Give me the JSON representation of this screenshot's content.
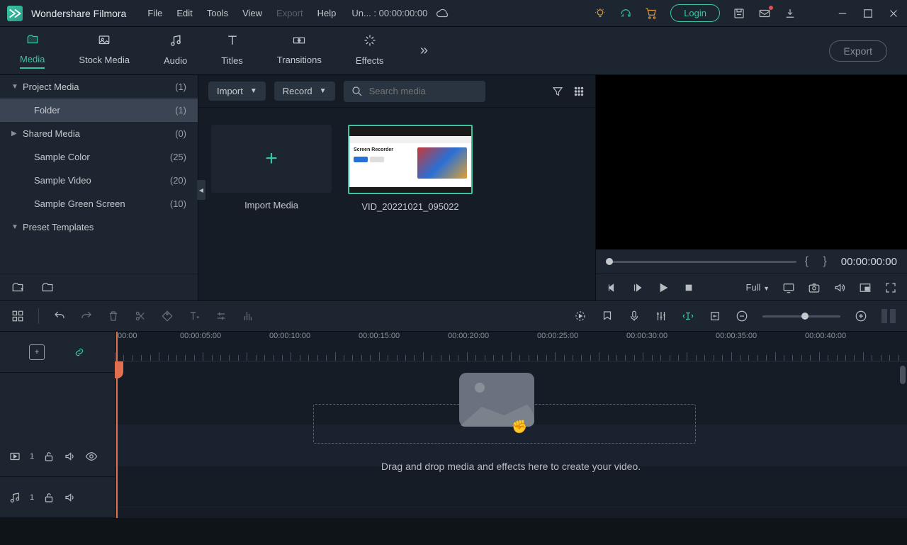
{
  "titlebar": {
    "app_name": "Wondershare Filmora",
    "menu": {
      "file": "File",
      "edit": "Edit",
      "tools": "Tools",
      "view": "View",
      "export": "Export",
      "help": "Help"
    },
    "project_info": "Un... : 00:00:00:00",
    "login": "Login"
  },
  "tabs": {
    "media": "Media",
    "stock": "Stock Media",
    "audio": "Audio",
    "titles": "Titles",
    "transitions": "Transitions",
    "effects": "Effects",
    "export": "Export"
  },
  "sidebar": {
    "project_media": {
      "label": "Project Media",
      "count": "(1)"
    },
    "folder": {
      "label": "Folder",
      "count": "(1)"
    },
    "shared_media": {
      "label": "Shared Media",
      "count": "(0)"
    },
    "sample_color": {
      "label": "Sample Color",
      "count": "(25)"
    },
    "sample_video": {
      "label": "Sample Video",
      "count": "(20)"
    },
    "sample_green": {
      "label": "Sample Green Screen",
      "count": "(10)"
    },
    "preset": {
      "label": "Preset Templates"
    }
  },
  "media_toolbar": {
    "import": "Import",
    "record": "Record",
    "search_placeholder": "Search media"
  },
  "media": {
    "import_label": "Import Media",
    "clip_name": "VID_20221021_095022",
    "thumb_text": "Screen Recorder"
  },
  "preview": {
    "timecode": "00:00:00:00",
    "quality": "Full"
  },
  "ruler": {
    "t0": "00:00",
    "t1": "00:00:05:00",
    "t2": "00:00:10:00",
    "t3": "00:00:15:00",
    "t4": "00:00:20:00",
    "t5": "00:00:25:00",
    "t6": "00:00:30:00",
    "t7": "00:00:35:00",
    "t8": "00:00:40:00"
  },
  "tracks": {
    "video_num": "1",
    "audio_num": "1"
  },
  "drop_hint": "Drag and drop media and effects here to create your video."
}
